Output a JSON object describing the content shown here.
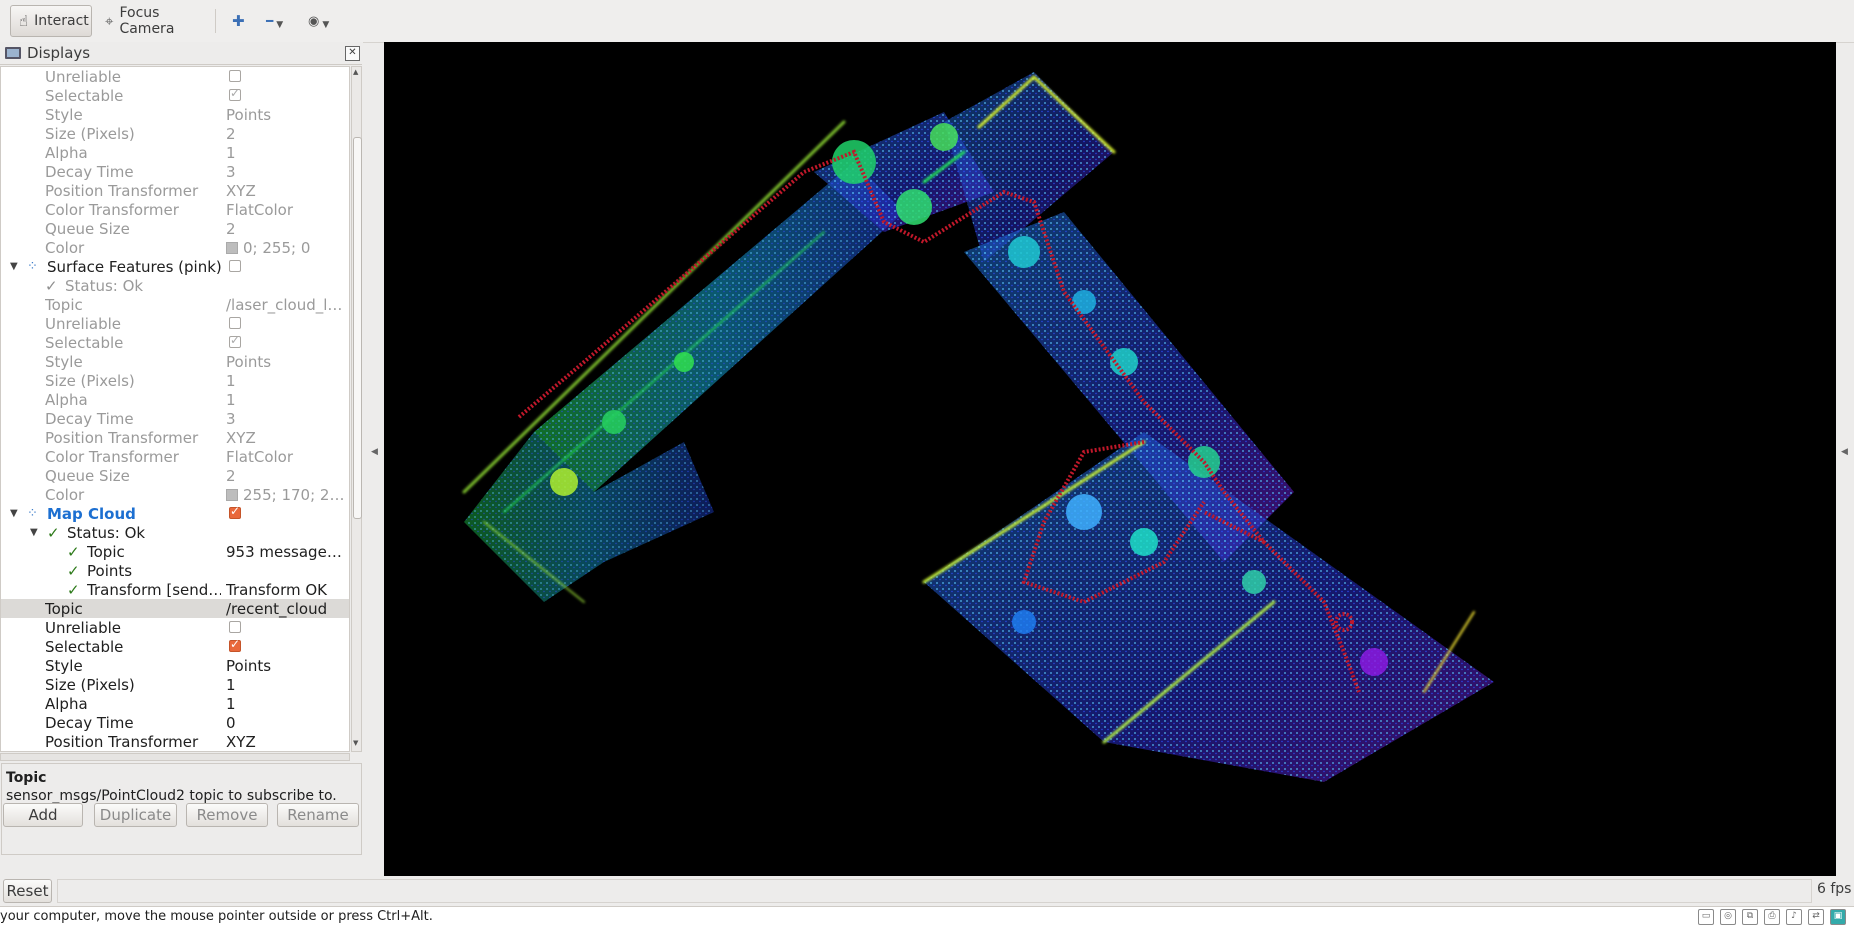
{
  "toolbar": {
    "interact_label": "Interact",
    "focus_camera_label": "Focus Camera",
    "tools": [
      {
        "name": "add-tool",
        "glyph": "✚"
      },
      {
        "name": "remove-tool",
        "glyph": "━"
      },
      {
        "name": "view-tool",
        "glyph": "◉"
      }
    ]
  },
  "panel": {
    "title": "Displays",
    "close_glyph": "✕",
    "rows": [
      {
        "indent": 0,
        "name": "Unreliable",
        "control": "checkbox",
        "checked": false,
        "style": "grey"
      },
      {
        "indent": 0,
        "name": "Selectable",
        "control": "checkbox",
        "checked": true,
        "style": "grey"
      },
      {
        "indent": 0,
        "name": "Style",
        "value": "Points",
        "style": "grey"
      },
      {
        "indent": 0,
        "name": "Size (Pixels)",
        "value": "2",
        "style": "grey"
      },
      {
        "indent": 0,
        "name": "Alpha",
        "value": "1",
        "style": "grey"
      },
      {
        "indent": 0,
        "name": "Decay Time",
        "value": "3",
        "style": "grey"
      },
      {
        "indent": 0,
        "name": "Position Transformer",
        "value": "XYZ",
        "style": "grey"
      },
      {
        "indent": 0,
        "name": "Color Transformer",
        "value": "FlatColor",
        "style": "grey"
      },
      {
        "indent": 0,
        "name": "Queue Size",
        "value": "2",
        "style": "grey"
      },
      {
        "indent": 0,
        "name": "Color",
        "value": "0; 255; 0",
        "swatch": "#00ff00",
        "style": "grey"
      },
      {
        "indent": 0,
        "name": "Surface Features (pink)",
        "display": true,
        "expanded": true,
        "control": "checkbox",
        "checked": false,
        "style": "dark"
      },
      {
        "indent": 0,
        "name": "Status: Ok",
        "status": "grey",
        "style": "grey"
      },
      {
        "indent": 0,
        "name": "Topic",
        "value": "/laser_cloud_le…",
        "style": "grey"
      },
      {
        "indent": 0,
        "name": "Unreliable",
        "control": "checkbox",
        "checked": false,
        "style": "grey"
      },
      {
        "indent": 0,
        "name": "Selectable",
        "control": "checkbox",
        "checked": true,
        "style": "grey"
      },
      {
        "indent": 0,
        "name": "Style",
        "value": "Points",
        "style": "grey"
      },
      {
        "indent": 0,
        "name": "Size (Pixels)",
        "value": "1",
        "style": "grey"
      },
      {
        "indent": 0,
        "name": "Alpha",
        "value": "1",
        "style": "grey"
      },
      {
        "indent": 0,
        "name": "Decay Time",
        "value": "3",
        "style": "grey"
      },
      {
        "indent": 0,
        "name": "Position Transformer",
        "value": "XYZ",
        "style": "grey"
      },
      {
        "indent": 0,
        "name": "Color Transformer",
        "value": "FlatColor",
        "style": "grey"
      },
      {
        "indent": 0,
        "name": "Queue Size",
        "value": "2",
        "style": "grey"
      },
      {
        "indent": 0,
        "name": "Color",
        "value": "255; 170; 255",
        "swatch": "#ffaaff",
        "style": "grey"
      },
      {
        "indent": 0,
        "name": "Map Cloud",
        "display": true,
        "expanded": true,
        "control": "checkbox-orange",
        "checked": true,
        "style": "blue"
      },
      {
        "indent": 1,
        "name": "Status: Ok",
        "status": "green",
        "expanded": true,
        "style": "dark"
      },
      {
        "indent": 2,
        "name": "Topic",
        "value": "953 messages …",
        "status": "green",
        "style": "dark"
      },
      {
        "indent": 2,
        "name": "Points",
        "value": "",
        "status": "green",
        "style": "dark"
      },
      {
        "indent": 2,
        "name": "Transform [send…",
        "value": "Transform OK",
        "status": "green",
        "style": "dark"
      },
      {
        "indent": 0,
        "name": "Topic",
        "value": "/recent_cloud",
        "style": "dark",
        "selected": true
      },
      {
        "indent": 0,
        "name": "Unreliable",
        "control": "checkbox",
        "checked": false,
        "style": "dark"
      },
      {
        "indent": 0,
        "name": "Selectable",
        "control": "checkbox-orange",
        "checked": true,
        "style": "dark"
      },
      {
        "indent": 0,
        "name": "Style",
        "value": "Points",
        "style": "dark"
      },
      {
        "indent": 0,
        "name": "Size (Pixels)",
        "value": "1",
        "style": "dark"
      },
      {
        "indent": 0,
        "name": "Alpha",
        "value": "1",
        "style": "dark"
      },
      {
        "indent": 0,
        "name": "Decay Time",
        "value": "0",
        "style": "dark"
      },
      {
        "indent": 0,
        "name": "Position Transformer",
        "value": "XYZ",
        "style": "dark"
      }
    ]
  },
  "description": {
    "title": "Topic",
    "text": "sensor_msgs/PointCloud2 topic to subscribe to."
  },
  "panel_buttons": {
    "add": "Add",
    "duplicate": "Duplicate",
    "remove": "Remove",
    "rename": "Rename"
  },
  "bottom": {
    "reset_label": "Reset",
    "fps": "6 fps"
  },
  "statusbar": {
    "text": "your computer, move the mouse pointer outside or press Ctrl+Alt."
  },
  "colors": {
    "map_cloud_blue": "#1c6fd1",
    "checkbox_orange": "#e9683b",
    "status_green": "#2d7a1a",
    "view_background": "#000000",
    "trajectory_red": "#c0182a"
  }
}
